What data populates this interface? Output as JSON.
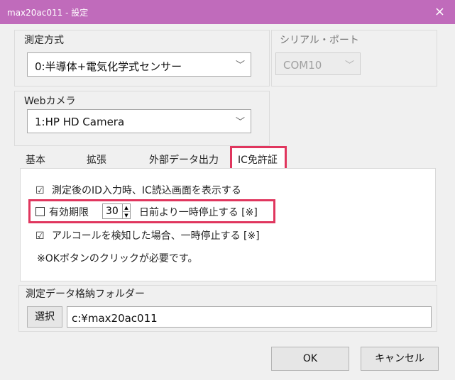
{
  "window": {
    "title": "max20ac011 - 設定",
    "close_glyph": "×",
    "title_bar_color": "#c06bbb"
  },
  "measurement": {
    "label": "測定方式",
    "selected": "0:半導体+電気化学式センサー"
  },
  "serial": {
    "label": "シリアル・ポート",
    "selected": "COM10"
  },
  "webcam": {
    "label": "Webカメラ",
    "selected": "1:HP HD Camera"
  },
  "tabs": [
    {
      "label": "基本"
    },
    {
      "label": "拡張"
    },
    {
      "label": "外部データ出力"
    },
    {
      "label": "IC免許証"
    }
  ],
  "options": {
    "opt1": {
      "checkbox": "☑",
      "label": "測定後のID入力時、IC読込画面を表示する"
    },
    "expiry_prefix": "有効期限",
    "expiry_value": "30",
    "expiry_suffix": "日前より一時停止する [※]",
    "opt3": {
      "checkbox": "☑",
      "label": "アルコールを検知した場合、一時停止する [※]"
    },
    "note": "※OKボタンのクリックが必要です。"
  },
  "folder": {
    "label": "測定データ格納フォルダー",
    "select_label": "選択",
    "path": "c:¥max20ac011"
  },
  "buttons": {
    "ok": "OK",
    "cancel": "キャンセル"
  },
  "colors": {
    "highlight": "#e0365e"
  },
  "icons": {
    "dropdown": "chevron-down-icon",
    "spin_up": "▲",
    "spin_down": "▼"
  }
}
